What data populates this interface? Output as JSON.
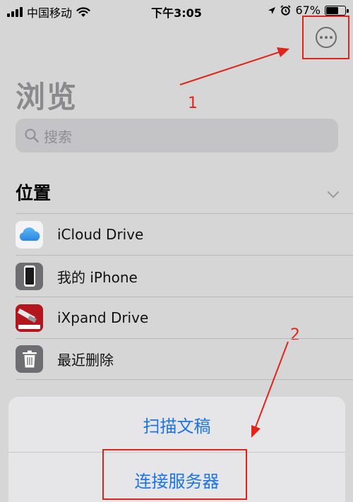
{
  "status_bar": {
    "carrier": "中国移动",
    "time": "下午3:05",
    "battery_percent": "67%",
    "battery_level": 0.67
  },
  "page": {
    "title": "浏览",
    "search_placeholder": "搜索"
  },
  "locations": {
    "header": "位置",
    "items": [
      {
        "label": "iCloud Drive",
        "icon": "icloud-icon"
      },
      {
        "label": "我的 iPhone",
        "icon": "iphone-icon"
      },
      {
        "label": "iXpand Drive",
        "icon": "sandisk-icon"
      },
      {
        "label": "最近删除",
        "icon": "trash-icon"
      }
    ]
  },
  "action_sheet": {
    "scan_label": "扫描文稿",
    "connect_label": "连接服务器"
  },
  "annotations": {
    "step1": "1",
    "step2": "2"
  },
  "colors": {
    "annotation": "#e0241b",
    "action_blue": "#1d74e6"
  }
}
